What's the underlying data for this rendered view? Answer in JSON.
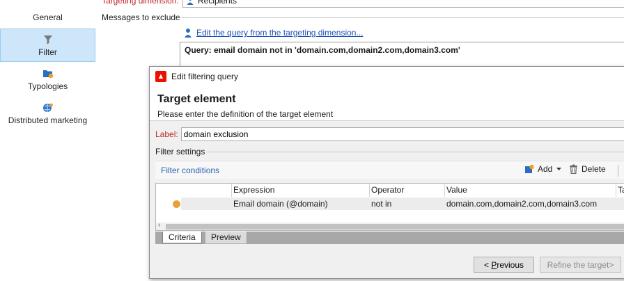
{
  "nav": {
    "items": [
      {
        "label": "General",
        "icon": "general-icon"
      },
      {
        "label": "Filter",
        "icon": "funnel-icon",
        "selected": true
      },
      {
        "label": "Typologies",
        "icon": "typology-icon"
      },
      {
        "label": "Distributed marketing",
        "icon": "distributed-marketing-icon"
      }
    ]
  },
  "properties": {
    "targeting_label": "Targeting dimension:",
    "targeting_value": "Recipients",
    "exclude_label": "Messages to exclude",
    "edit_link": "Edit the query from the targeting dimension...",
    "query_text": "Query: email domain not in 'domain.com,domain2.com,domain3.com'"
  },
  "dialog": {
    "title": "Edit filtering query",
    "heading": "Target element",
    "subheading": "Please enter the definition of the target element",
    "label_caption": "Label:",
    "label_value": "domain exclusion",
    "filter_settings": "Filter settings",
    "filter_conditions": "Filter conditions",
    "toolbar": {
      "add": "Add",
      "delete": "Delete"
    },
    "grid": {
      "columns": [
        "Expression",
        "Operator",
        "Value",
        "Ta"
      ],
      "rows": [
        {
          "expression": "Email domain (@domain)",
          "operator": "not in",
          "value": "domain.com,domain2.com,domain3.com"
        }
      ]
    },
    "tabs": [
      "Criteria",
      "Preview"
    ],
    "buttons": {
      "previous_prefix": "< ",
      "previous_accel": "P",
      "previous_rest": "revious",
      "refine": "Refine the target>"
    }
  },
  "colors": {
    "accent_red": "#c0282d",
    "link_blue": "#1a4fb5",
    "selection_blue": "#cde6fa",
    "status_orange": "#e8a23c"
  }
}
